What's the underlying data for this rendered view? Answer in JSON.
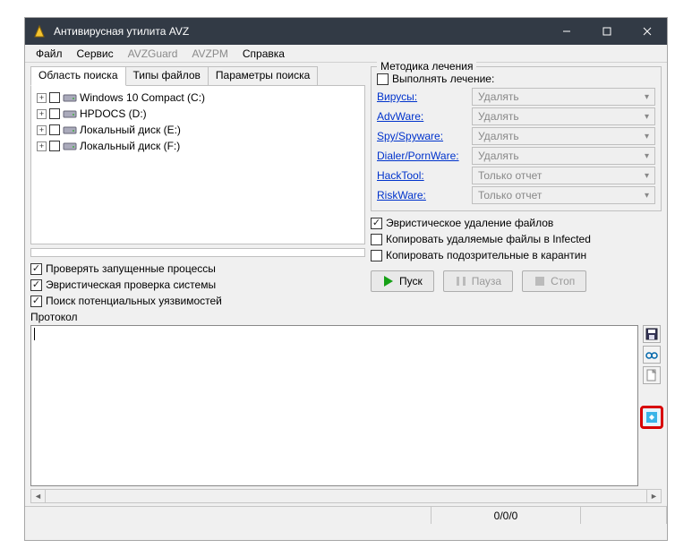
{
  "window": {
    "title": "Антивирусная утилита AVZ"
  },
  "menu": {
    "file": "Файл",
    "service": "Сервис",
    "avzguard": "AVZGuard",
    "avzpm": "AVZPM",
    "help": "Справка"
  },
  "tabs": {
    "scan_area": "Область поиска",
    "file_types": "Типы файлов",
    "scan_params": "Параметры поиска"
  },
  "drives": [
    {
      "label": "Windows 10 Compact (C:)"
    },
    {
      "label": "HPDOCS (D:)"
    },
    {
      "label": "Локальный диск (E:)"
    },
    {
      "label": "Локальный диск (F:)"
    }
  ],
  "left_checks": {
    "running_processes": "Проверять запущенные процессы",
    "heuristic_system": "Эвристическая проверка системы",
    "vulnerabilities": "Поиск потенциальных уязвимостей"
  },
  "treatment": {
    "legend": "Методика лечения",
    "perform": "Выполнять лечение:",
    "rows": [
      {
        "name": "Вирусы:",
        "action": "Удалять"
      },
      {
        "name": "AdvWare:",
        "action": "Удалять"
      },
      {
        "name": "Spy/Spyware:",
        "action": "Удалять"
      },
      {
        "name": "Dialer/PornWare:",
        "action": "Удалять"
      },
      {
        "name": "HackTool:",
        "action": "Только отчет"
      },
      {
        "name": "RiskWare:",
        "action": "Только отчет"
      }
    ],
    "heur_delete": "Эвристическое удаление файлов",
    "copy_infected": "Копировать удаляемые файлы в  Infected",
    "copy_quarantine": "Копировать подозрительные в  карантин"
  },
  "buttons": {
    "start": "Пуск",
    "pause": "Пауза",
    "stop": "Стоп"
  },
  "protocol": {
    "label": "Протокол"
  },
  "status": {
    "counters": "0/0/0"
  }
}
